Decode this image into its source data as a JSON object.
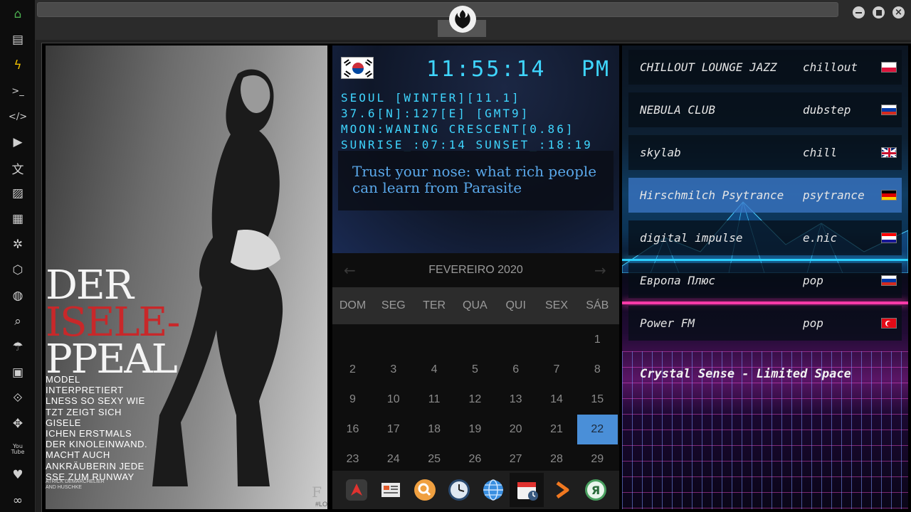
{
  "sidebar": {
    "items": [
      {
        "icon": "home-icon",
        "glyph": "⌂",
        "color": "#4caf50"
      },
      {
        "icon": "document-icon",
        "glyph": "▤"
      },
      {
        "icon": "lightning-icon",
        "glyph": "ϟ",
        "color": "#f0c000"
      },
      {
        "icon": "terminal-icon",
        "glyph": ">_"
      },
      {
        "icon": "code-icon",
        "glyph": "</>"
      },
      {
        "icon": "play-icon",
        "glyph": "▶"
      },
      {
        "icon": "translate-icon",
        "glyph": "文"
      },
      {
        "icon": "image-icon",
        "glyph": "▨"
      },
      {
        "icon": "newspaper-icon",
        "glyph": "▦"
      },
      {
        "icon": "rebel-icon",
        "glyph": "✲"
      },
      {
        "icon": "hexagon-icon",
        "glyph": "⬡"
      },
      {
        "icon": "globe-icon",
        "glyph": "◍"
      },
      {
        "icon": "search-icon",
        "glyph": "⌕"
      },
      {
        "icon": "umbrella-icon",
        "glyph": "☂"
      },
      {
        "icon": "contact-icon",
        "glyph": "▣"
      },
      {
        "icon": "link-icon",
        "glyph": "⟐"
      },
      {
        "icon": "expand-icon",
        "glyph": "✥"
      },
      {
        "icon": "youtube-icon",
        "glyph": "You\nTube"
      },
      {
        "icon": "heart-icon",
        "glyph": "♥"
      },
      {
        "icon": "cloud-icon",
        "glyph": "∞"
      }
    ]
  },
  "magazine": {
    "headline_1": "DER",
    "headline_2": "ISELE-",
    "headline_3": "PPEAL",
    "body_lines": [
      "MODEL INTERPRETIERT",
      "LNESS SO SEXY WIE",
      "TZT ZEIGT SICH GISELE",
      "ICHEN ERSTMALS",
      "DER KINOLEINWAND.",
      "MACHT AUCH",
      "ANKRÄUBERIN JEDE",
      "SSE ZUM RUNWAY"
    ],
    "credit_1": "ATRICK DEMARCHELIER",
    "credit_2": "AND HUSCHKE",
    "corner": "F",
    "corner_small": "#LO"
  },
  "clock": {
    "time": "11:55:14",
    "ampm": "PM",
    "location": "SEOUL [WINTER][11.1]",
    "coords": "37.6[N]:127[E] [GMT9]",
    "moon": "MOON:WANING CRESCENT[0.86]",
    "sun": "SUNRISE_:07:14 SUNSET_:18:19",
    "news": "Trust your nose: what rich people can learn from Parasite",
    "color": "#3fd6ff"
  },
  "calendar": {
    "month_label": "FEVEREIRO 2020",
    "prev": "←",
    "next": "→",
    "weekdays": [
      "DOM",
      "SEG",
      "TER",
      "QUA",
      "QUI",
      "SEX",
      "SÁB"
    ],
    "first_weekday_index": 6,
    "days_shown": 29,
    "selected_day": 22,
    "accent": "#4a8fd8"
  },
  "dock": {
    "items": [
      {
        "icon": "launcher-icon"
      },
      {
        "icon": "news-app-icon"
      },
      {
        "icon": "search-app-icon"
      },
      {
        "icon": "clock-app-icon"
      },
      {
        "icon": "browser-globe-icon"
      },
      {
        "icon": "calendar-app-icon"
      },
      {
        "icon": "forward-arrow-icon"
      },
      {
        "icon": "yandex-icon",
        "label": "Я"
      }
    ]
  },
  "radio": {
    "stations": [
      {
        "name": "CHILLOUT LOUNGE JAZZ",
        "genre": "chillout",
        "flag": "pl"
      },
      {
        "name": "NEBULA CLUB",
        "genre": "dubstep",
        "flag": "ru"
      },
      {
        "name": "skylab",
        "genre": "chill",
        "flag": "gb"
      },
      {
        "name": "Hirschmilch Psytrance",
        "genre": "psytrance",
        "flag": "de",
        "active": true
      },
      {
        "name": "digital impulse",
        "genre": "e.nic",
        "flag": "hr"
      },
      {
        "name": "Европа Плюс",
        "genre": "pop",
        "flag": "ru"
      },
      {
        "name": "Power FM",
        "genre": "pop",
        "flag": "tr"
      }
    ],
    "now_playing": "Crystal Sense - Limited Space"
  }
}
